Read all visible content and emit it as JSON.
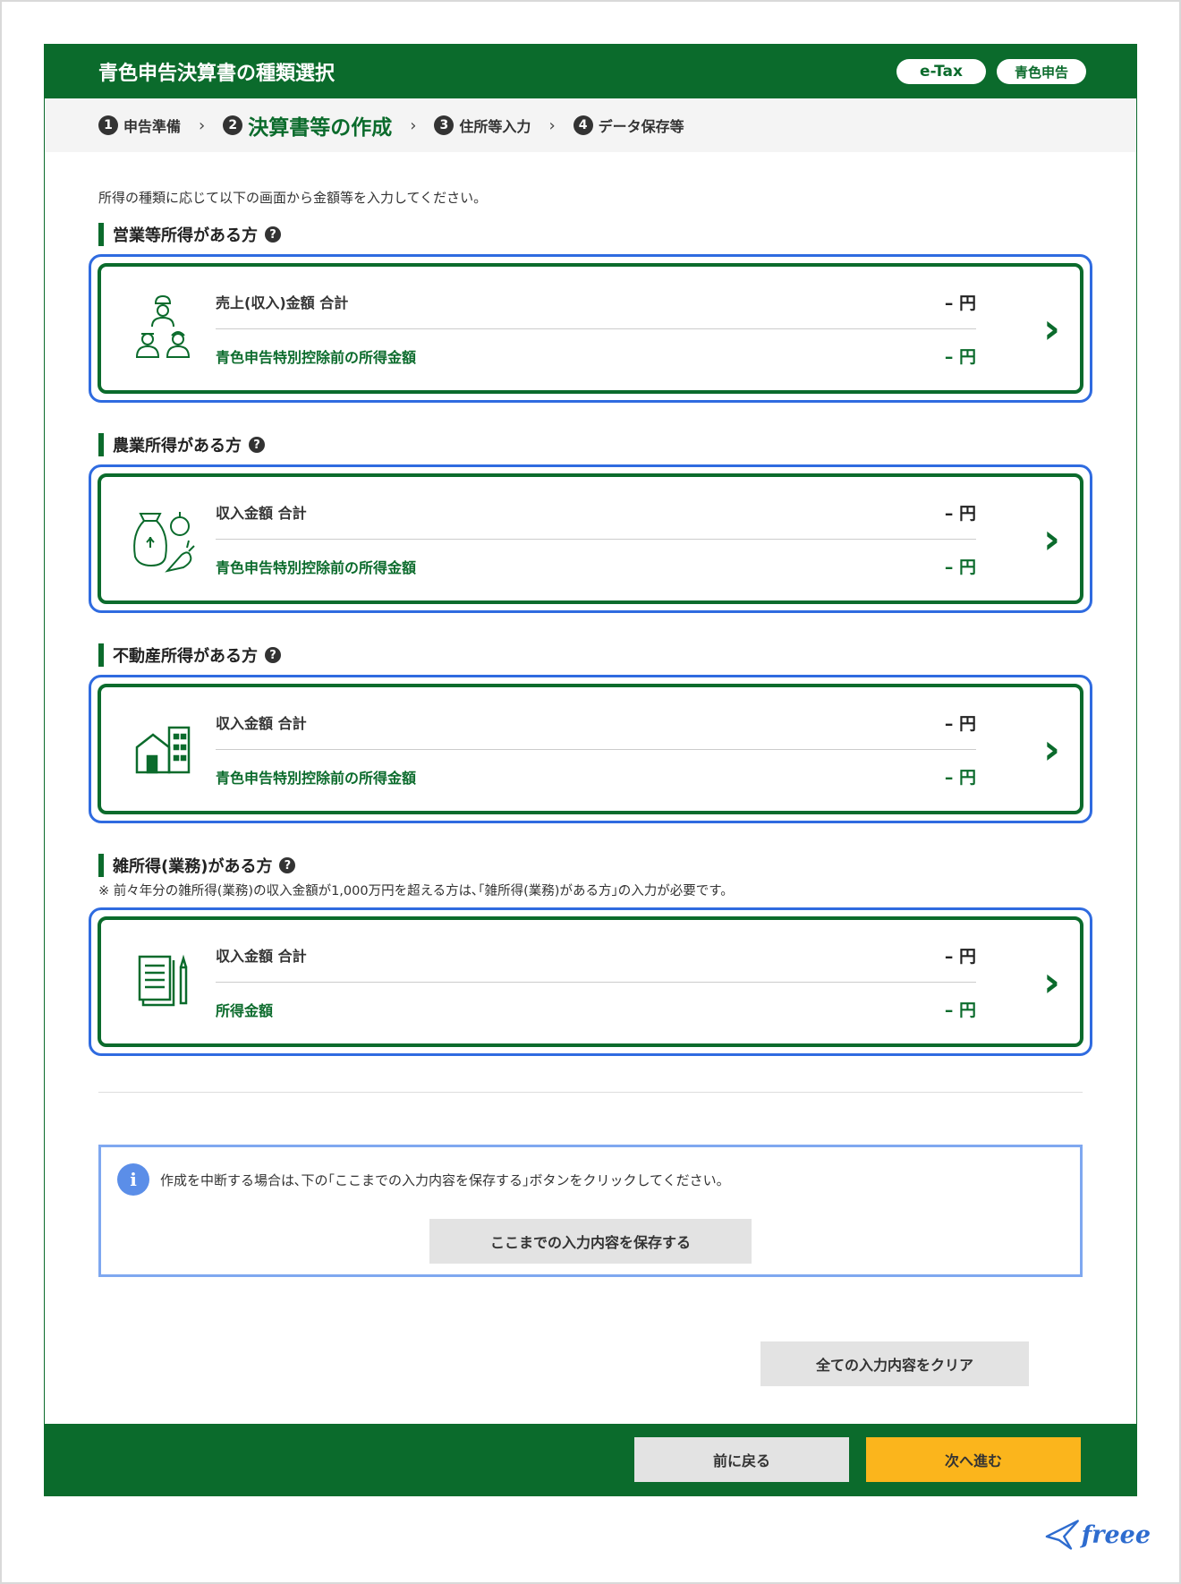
{
  "header": {
    "title": "青色申告決算書の種類選択",
    "badge_etax": "e-Tax",
    "badge_blue": "青色申告"
  },
  "steps": [
    {
      "num": "1",
      "label": "申告準備"
    },
    {
      "num": "2",
      "label": "決算書等の作成"
    },
    {
      "num": "3",
      "label": "住所等入力"
    },
    {
      "num": "4",
      "label": "データ保存等"
    }
  ],
  "intro": "所得の種類に応じて以下の画面から金額等を入力してください。",
  "sections": {
    "business": {
      "title": "営業等所得がある方",
      "row1_label": "売上(収入)金額 合計",
      "row1_value": "– 円",
      "row2_label": "青色申告特別控除前の所得金額",
      "row2_value": "– 円"
    },
    "agri": {
      "title": "農業所得がある方",
      "row1_label": "収入金額 合計",
      "row1_value": "– 円",
      "row2_label": "青色申告特別控除前の所得金額",
      "row2_value": "– 円"
    },
    "realestate": {
      "title": "不動産所得がある方",
      "row1_label": "収入金額 合計",
      "row1_value": "– 円",
      "row2_label": "青色申告特別控除前の所得金額",
      "row2_value": "– 円"
    },
    "misc": {
      "title": "雑所得(業務)がある方",
      "note": "※ 前々年分の雑所得(業務)の収入金額が1,000万円を超える方は､｢雑所得(業務)がある方｣の入力が必要です。",
      "row1_label": "収入金額 合計",
      "row1_value": "– 円",
      "row2_label": "所得金額",
      "row2_value": "– 円"
    }
  },
  "help_glyph": "?",
  "chevron_glyph": "›",
  "info": {
    "icon": "i",
    "text": "作成を中断する場合は､下の｢ここまでの入力内容を保存する｣ボタンをクリックしてください。",
    "save_label": "ここまでの入力内容を保存する"
  },
  "clear_label": "全ての入力内容をクリア",
  "footer": {
    "back_label": "前に戻る",
    "next_label": "次へ進む"
  },
  "logo_text": "freee",
  "colors": {
    "primary_green": "#0b6b2c",
    "highlight_blue": "#2f6be0",
    "next_yellow": "#fbb51c"
  }
}
